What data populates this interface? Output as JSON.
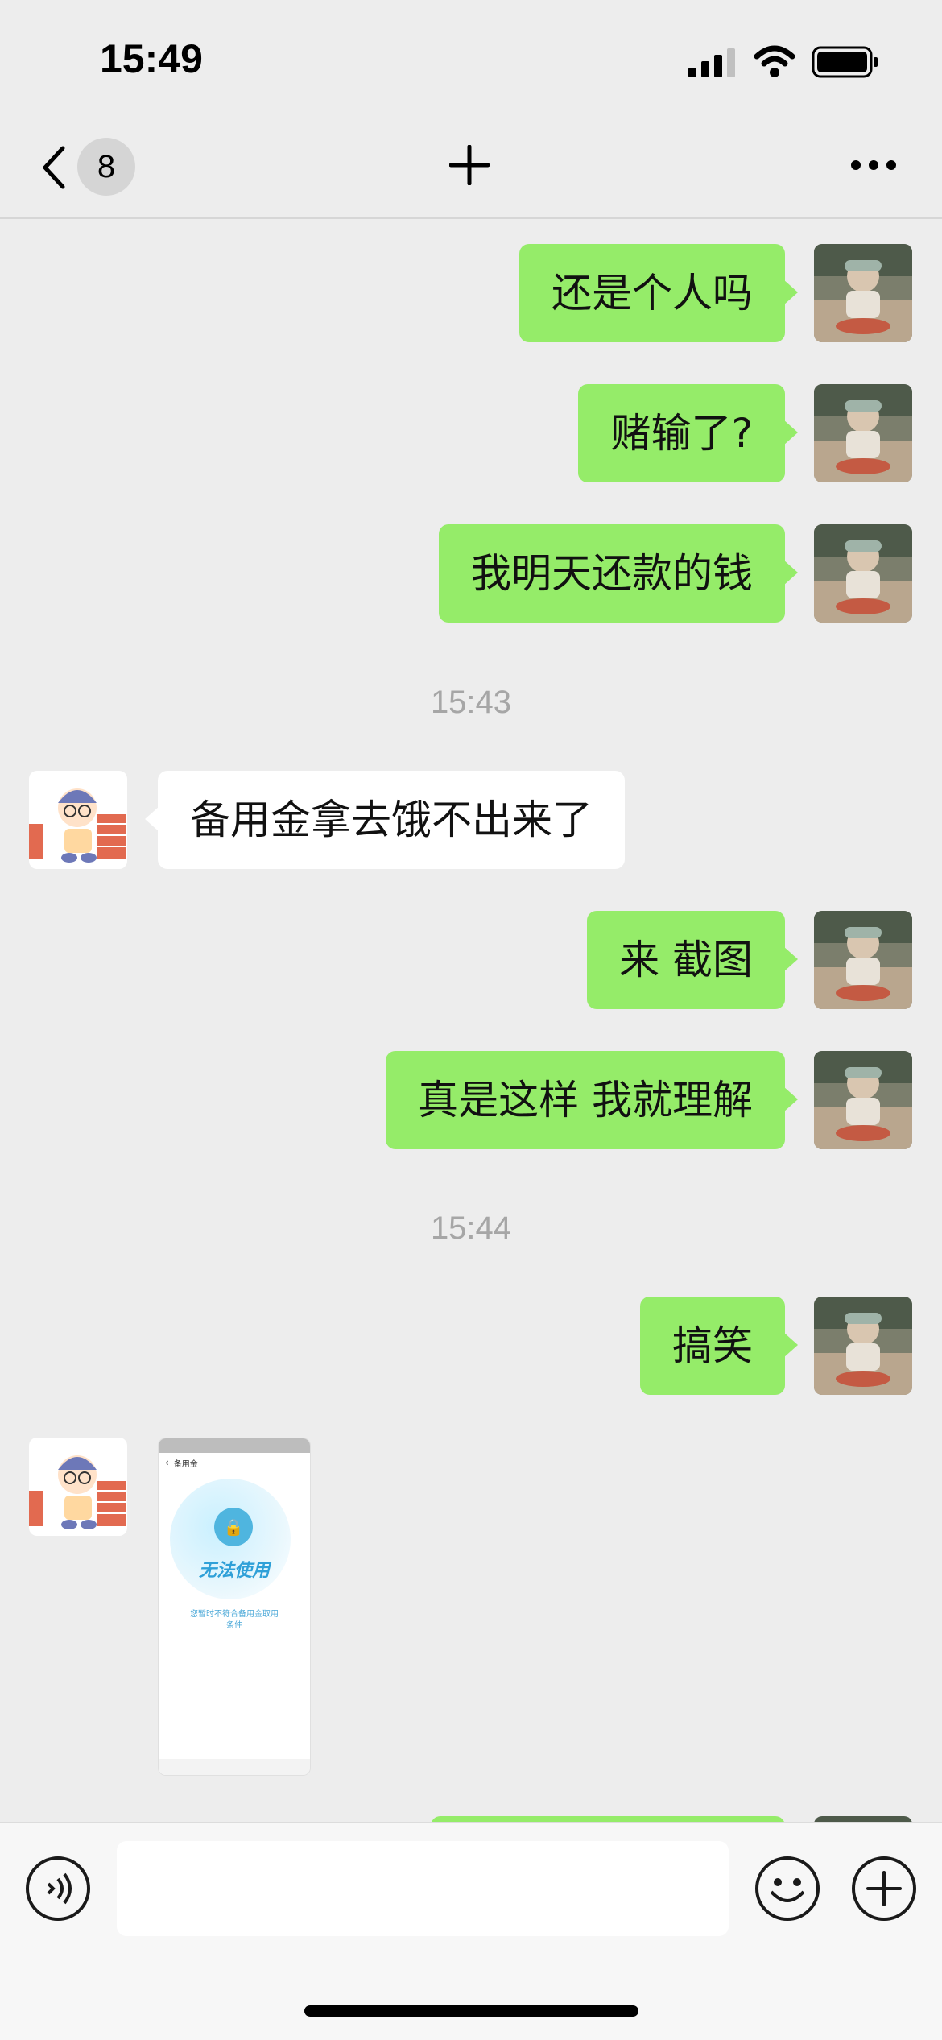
{
  "status_bar": {
    "time": "15:49"
  },
  "nav": {
    "unread_count": "8"
  },
  "messages": [
    {
      "side": "out",
      "text": "还是个人吗"
    },
    {
      "side": "out",
      "text": "赌输了?"
    },
    {
      "side": "out",
      "text": "我明天还款的钱"
    },
    {
      "side": "time",
      "text": "15:43"
    },
    {
      "side": "in",
      "text": "备用金拿去饿不出来了"
    },
    {
      "side": "out",
      "text": "来 截图"
    },
    {
      "side": "out",
      "text": "真是这样 我就理解"
    },
    {
      "side": "time",
      "text": "15:44"
    },
    {
      "side": "out",
      "text": "搞笑"
    }
  ],
  "screenshot_thumb": {
    "header": "备用金",
    "status": "无法使用",
    "note_line1": "您暂时不符合备用金取用",
    "note_line2": "条件"
  },
  "colors": {
    "outgoing": "#95ec69",
    "incoming": "#ffffff",
    "background": "#ededed"
  }
}
